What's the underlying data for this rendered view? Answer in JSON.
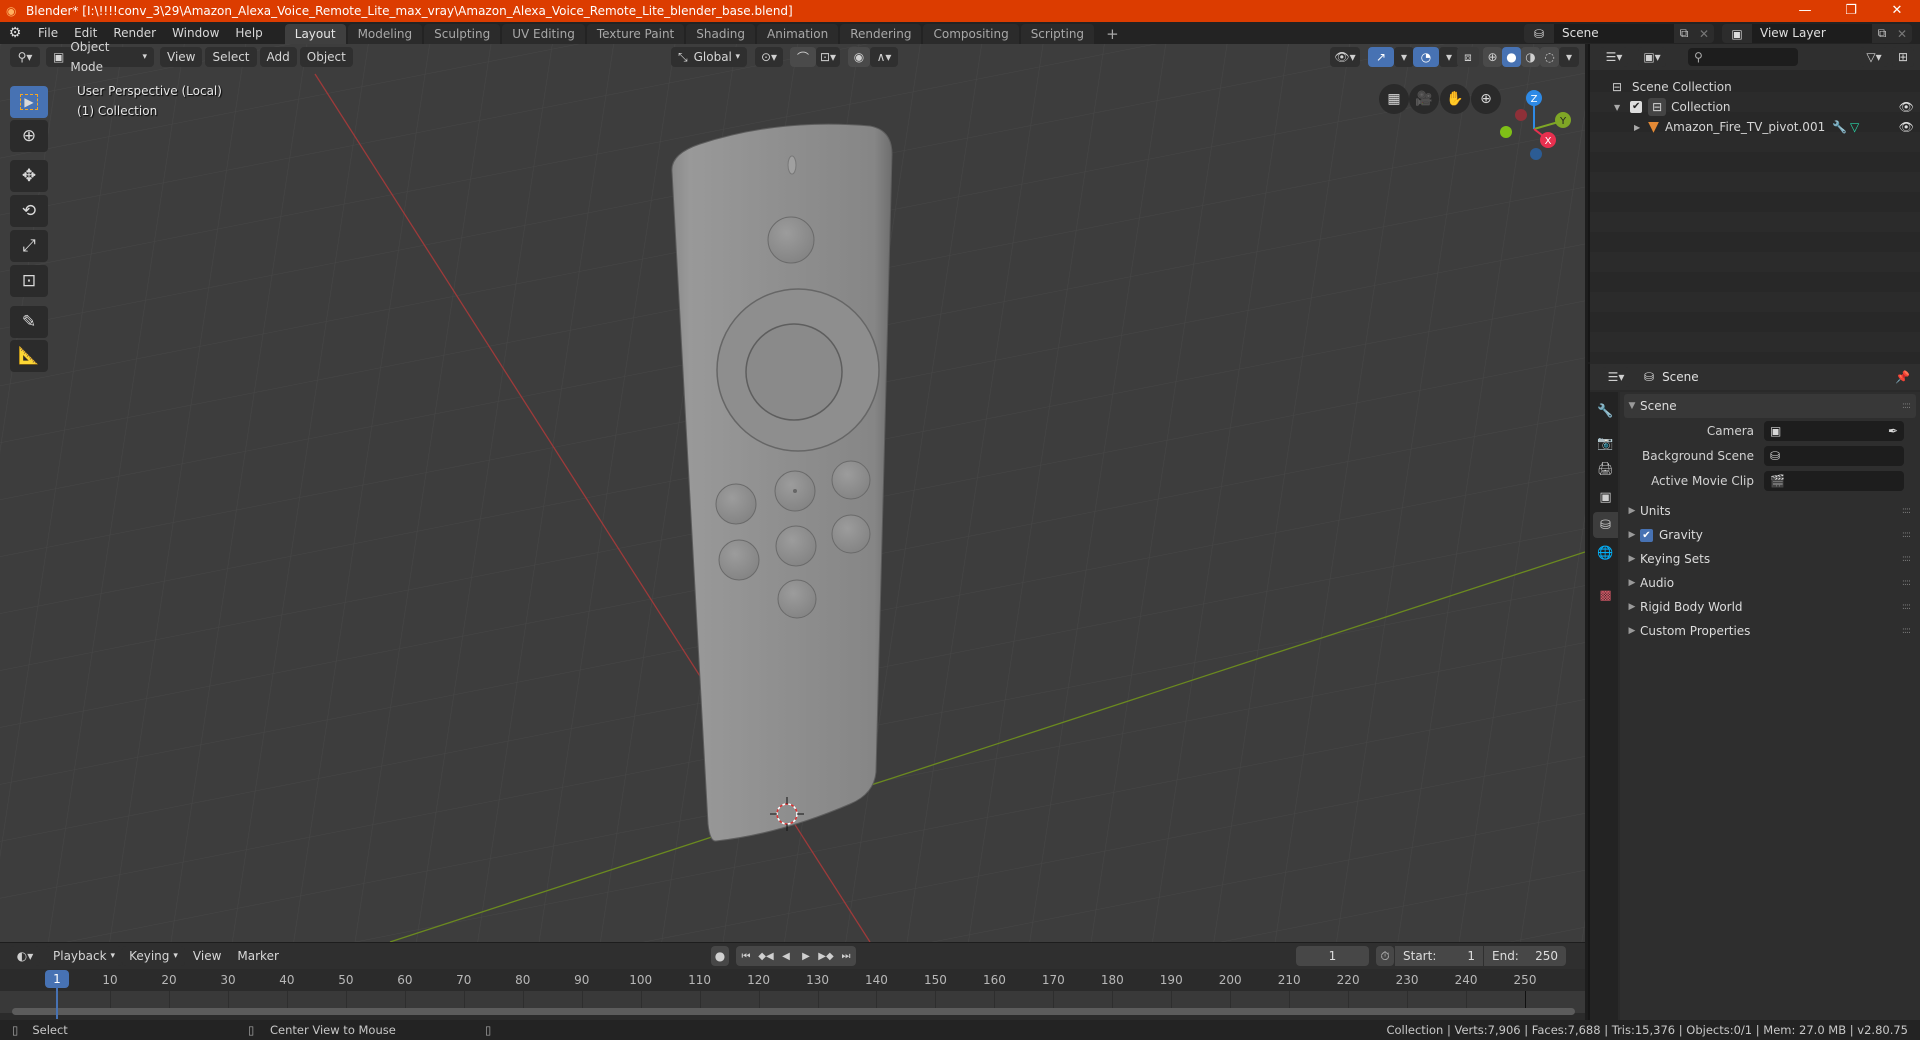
{
  "titlebar": {
    "title": "Blender* [I:\\!!!!conv_3\\29\\Amazon_Alexa_Voice_Remote_Lite_max_vray\\Amazon_Alexa_Voice_Remote_Lite_blender_base.blend]",
    "minimize": "—",
    "maximize": "❐",
    "close": "✕"
  },
  "menubar": {
    "items": [
      "File",
      "Edit",
      "Render",
      "Window",
      "Help"
    ]
  },
  "workspaces": {
    "tabs": [
      "Layout",
      "Modeling",
      "Sculpting",
      "UV Editing",
      "Texture Paint",
      "Shading",
      "Animation",
      "Rendering",
      "Compositing",
      "Scripting"
    ],
    "active": "Layout",
    "add_label": "+"
  },
  "scene_selector": {
    "value": "Scene"
  },
  "viewlayer_selector": {
    "value": "View Layer"
  },
  "viewport_header": {
    "mode": "Object Mode",
    "menus": [
      "View",
      "Select",
      "Add",
      "Object"
    ],
    "transform_orientation": "Global"
  },
  "viewport": {
    "perspective_label": "User Perspective (Local)",
    "collection_label": "(1) Collection",
    "gizmo_axes": {
      "x": "X",
      "y": "Y",
      "z": "Z"
    },
    "colors": {
      "x_axis": "#9e3a3a",
      "y_axis": "#6b8a1f",
      "x_gizmo": "#e8304f",
      "y_gizmo": "#7fa726",
      "z_gizmo": "#2e8ae6"
    }
  },
  "tools": [
    "select-box",
    "cursor",
    "move",
    "rotate",
    "scale",
    "transform",
    "annotate",
    "measure"
  ],
  "outliner": {
    "search_placeholder": "",
    "rows": [
      {
        "label": "Scene Collection",
        "icon": "collection-icon"
      },
      {
        "label": "Collection",
        "icon": "collection-icon",
        "checked": true
      },
      {
        "label": "Amazon_Fire_TV_pivot.001",
        "icon": "mesh-object-icon"
      }
    ]
  },
  "properties": {
    "context": "Scene",
    "scene_panel": {
      "title": "Scene",
      "fields": [
        {
          "label": "Camera",
          "value": ""
        },
        {
          "label": "Background Scene",
          "value": ""
        },
        {
          "label": "Active Movie Clip",
          "value": ""
        }
      ]
    },
    "subpanels": [
      {
        "label": "Units",
        "checkbox": false
      },
      {
        "label": "Gravity",
        "checkbox": true
      },
      {
        "label": "Keying Sets",
        "checkbox": false
      },
      {
        "label": "Audio",
        "checkbox": false
      },
      {
        "label": "Rigid Body World",
        "checkbox": false
      },
      {
        "label": "Custom Properties",
        "checkbox": false
      }
    ]
  },
  "timeline": {
    "menus": [
      "Playback",
      "Keying",
      "View",
      "Marker"
    ],
    "current_frame": "1",
    "start_label": "Start:",
    "start_value": "1",
    "end_label": "End:",
    "end_value": "250",
    "ruler_ticks": [
      "10",
      "20",
      "30",
      "40",
      "50",
      "60",
      "70",
      "80",
      "90",
      "100",
      "110",
      "120",
      "130",
      "140",
      "150",
      "160",
      "170",
      "180",
      "190",
      "200",
      "210",
      "220",
      "230",
      "240",
      "250"
    ],
    "playhead_label": "1"
  },
  "statusbar": {
    "left_action": "Select",
    "middle_action": "Center View to Mouse",
    "stats": "Collection | Verts:7,906 | Faces:7,688 | Tris:15,376 | Objects:0/1 | Mem: 27.0 MB | v2.80.75"
  }
}
